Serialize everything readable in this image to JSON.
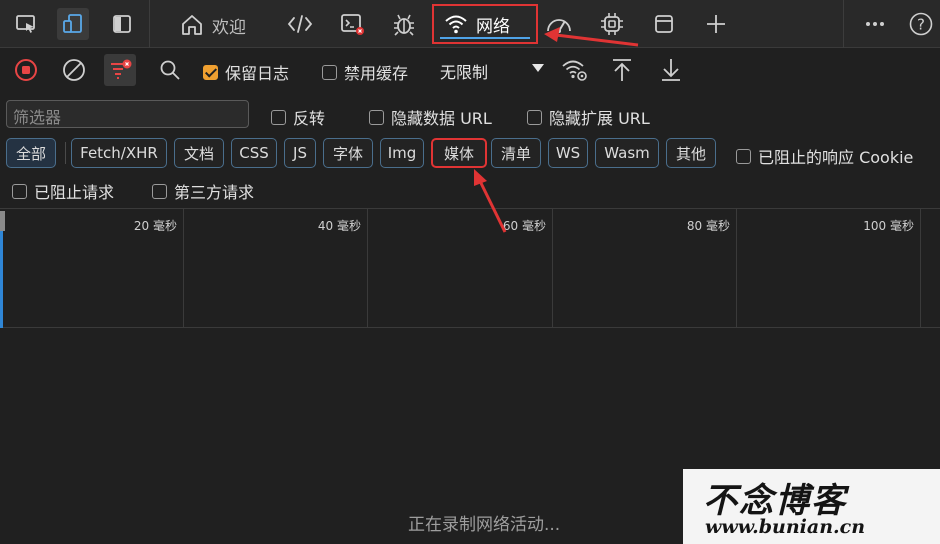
{
  "tabs": {
    "welcome": "欢迎",
    "network": "网络"
  },
  "toolbar": {
    "preserve_log": "保留日志",
    "disable_cache": "禁用缓存",
    "throttling": "无限制"
  },
  "filter": {
    "placeholder": "筛选器",
    "invert": "反转",
    "hide_data_urls": "隐藏数据 URL",
    "hide_extension_urls": "隐藏扩展 URL"
  },
  "types": [
    "全部",
    "Fetch/XHR",
    "文档",
    "CSS",
    "JS",
    "字体",
    "Img",
    "媒体",
    "清单",
    "WS",
    "Wasm",
    "其他"
  ],
  "options": {
    "blocked_cookies": "已阻止的响应 Cookie",
    "blocked_requests": "已阻止请求",
    "third_party": "第三方请求"
  },
  "timeline": [
    "20 毫秒",
    "40 毫秒",
    "60 毫秒",
    "80 毫秒",
    "100 毫秒"
  ],
  "status": "正在录制网络活动...",
  "watermark": {
    "title": "不念博客",
    "url": "www.bunian.cn"
  },
  "colors": {
    "highlight": "#e03434",
    "accent": "#2f86d6",
    "checkbox_on": "#f0a030"
  }
}
